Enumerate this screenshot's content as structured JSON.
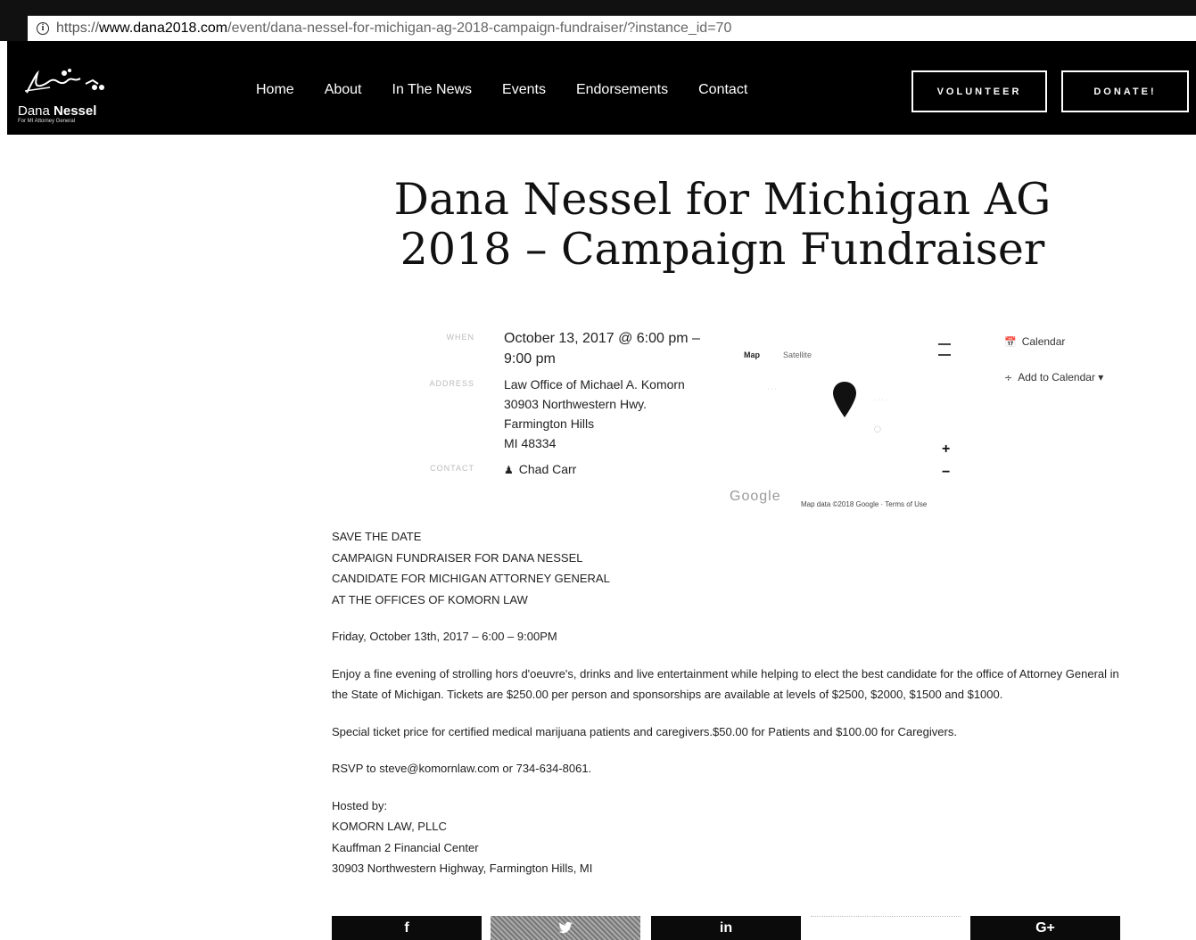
{
  "browser": {
    "url_proto": "https://",
    "url_domain": "www.dana2018.com",
    "url_path": "/event/dana-nessel-for-michigan-ag-2018-campaign-fundraiser/?instance_id=70"
  },
  "header": {
    "logo_first": "Dana",
    "logo_last": "Nessel",
    "logo_sub": "For MI Attorney General",
    "nav": [
      "Home",
      "About",
      "In The News",
      "Events",
      "Endorsements",
      "Contact"
    ],
    "volunteer_label": "VOLUNTEER",
    "donate_label": "DONATE!"
  },
  "event": {
    "title": "Dana Nessel for Michigan AG 2018 – Campaign Fundraiser",
    "labels": {
      "when": "WHEN",
      "address": "ADDRESS",
      "contact": "CONTACT"
    },
    "when": "October 13, 2017 @ 6:00 pm – 9:00 pm",
    "address": [
      "Law Office of Michael A. Komorn",
      "30903 Northwestern Hwy.",
      "Farmington Hills",
      "MI 48334"
    ],
    "contact": "Chad Carr"
  },
  "map": {
    "tab_map": "Map",
    "tab_satellite": "Satellite",
    "zoom_in": "+",
    "zoom_out": "−",
    "google": "Google",
    "map_data": "Map data ©2018 Google · Terms of Use"
  },
  "sidebar": {
    "calendar": "Calendar",
    "add_to_calendar": "Add to Calendar"
  },
  "body": {
    "save_lines": [
      "SAVE THE DATE",
      "CAMPAIGN FUNDRAISER FOR DANA NESSEL",
      "CANDIDATE FOR MICHIGAN ATTORNEY GENERAL",
      "AT THE OFFICES OF KOMORN LAW"
    ],
    "date_line": "Friday, October 13th, 2017 – 6:00 – 9:00PM",
    "enjoy": "Enjoy a fine evening of strolling hors d'oeuvre's, drinks and live entertainment while helping to elect the best candidate for the office of Attorney General in the State of Michigan. Tickets are $250.00 per person and sponsorships are available at levels of $2500, $2000, $1500 and $1000.",
    "special": "Special ticket price for certified medical marijuana patients and caregivers.$50.00 for Patients and $100.00 for Caregivers.",
    "rsvp": "RSVP to steve@komornlaw.com or 734-634-8061.",
    "hosted_lines": [
      "Hosted by:",
      "KOMORN LAW, PLLC",
      "Kauffman 2 Financial Center",
      "30903 Northwestern Highway, Farmington Hills, MI"
    ]
  },
  "share": {
    "facebook": "f",
    "linkedin": "in",
    "google_plus": "G+"
  }
}
